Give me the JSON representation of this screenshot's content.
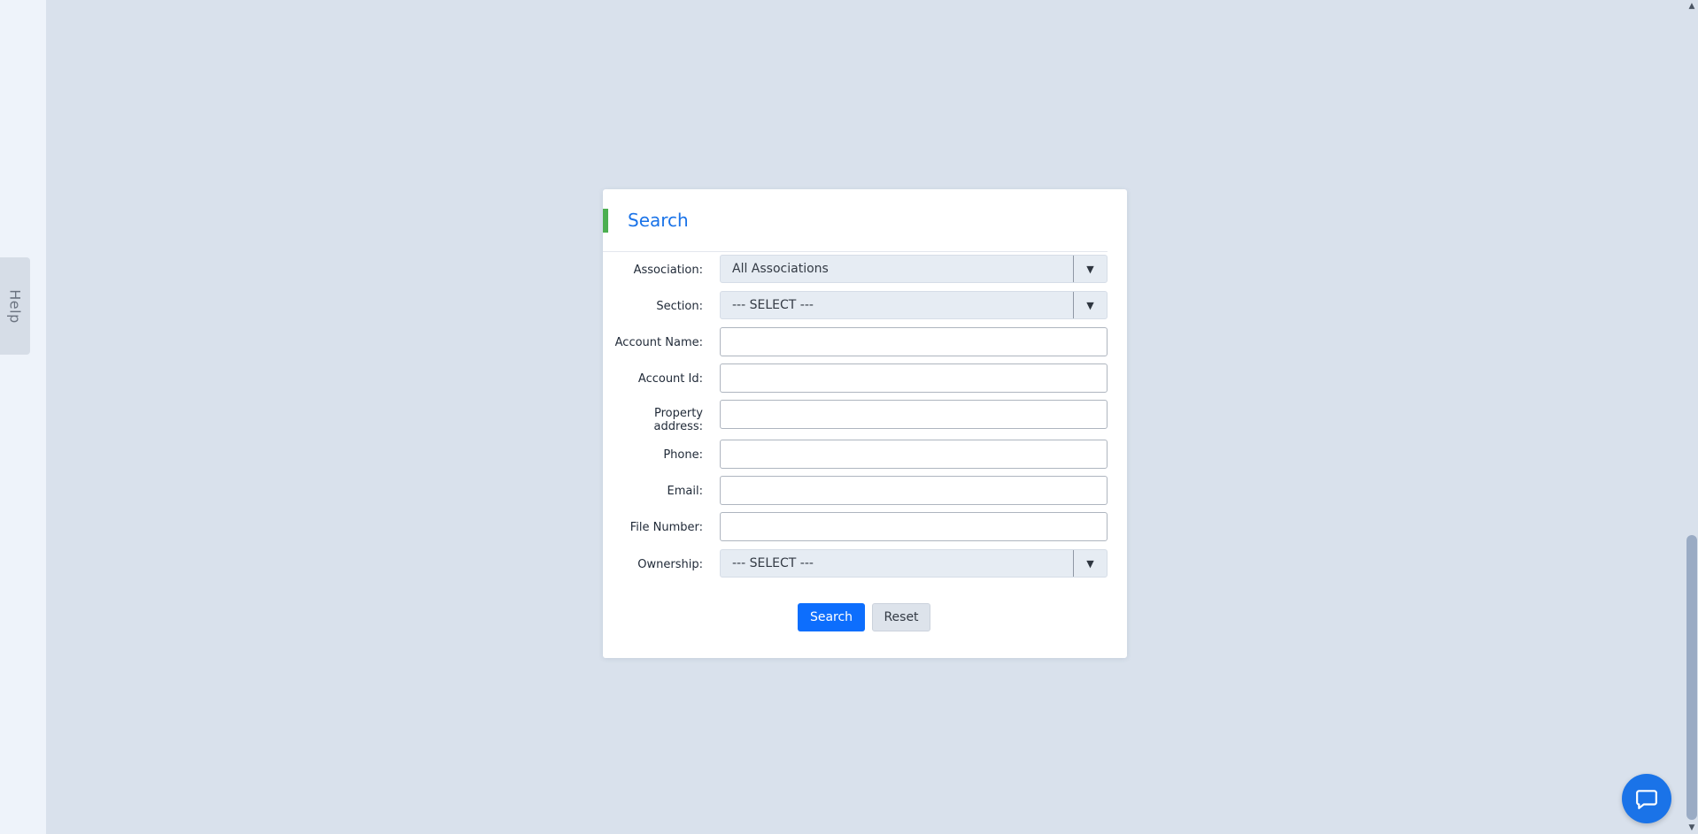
{
  "help_tab": {
    "label": "Help"
  },
  "search_panel": {
    "title": "Search",
    "fields": {
      "association": {
        "label": "Association:",
        "value": "All Associations"
      },
      "section": {
        "label": "Section:",
        "value": "--- SELECT ---"
      },
      "account_name": {
        "label": "Account Name:",
        "value": ""
      },
      "account_id": {
        "label": "Account Id:",
        "value": ""
      },
      "property_address": {
        "label": "Property address:",
        "value": ""
      },
      "phone": {
        "label": "Phone:",
        "value": ""
      },
      "email": {
        "label": "Email:",
        "value": ""
      },
      "file_number": {
        "label": "File Number:",
        "value": ""
      },
      "ownership": {
        "label": "Ownership:",
        "value": "--- SELECT ---"
      }
    },
    "buttons": {
      "search": "Search",
      "reset": "Reset"
    }
  },
  "colors": {
    "background": "#d9e1ec",
    "accent_bar": "#4caf50",
    "title": "#1a73e8",
    "primary_button": "#0d6efd",
    "chat_button": "#1a73e8"
  },
  "icons": {
    "dropdown": "triangle-down-icon",
    "chat": "chat-bubble-icon",
    "scroll_up": "chevron-up-icon",
    "scroll_down": "chevron-down-icon"
  }
}
